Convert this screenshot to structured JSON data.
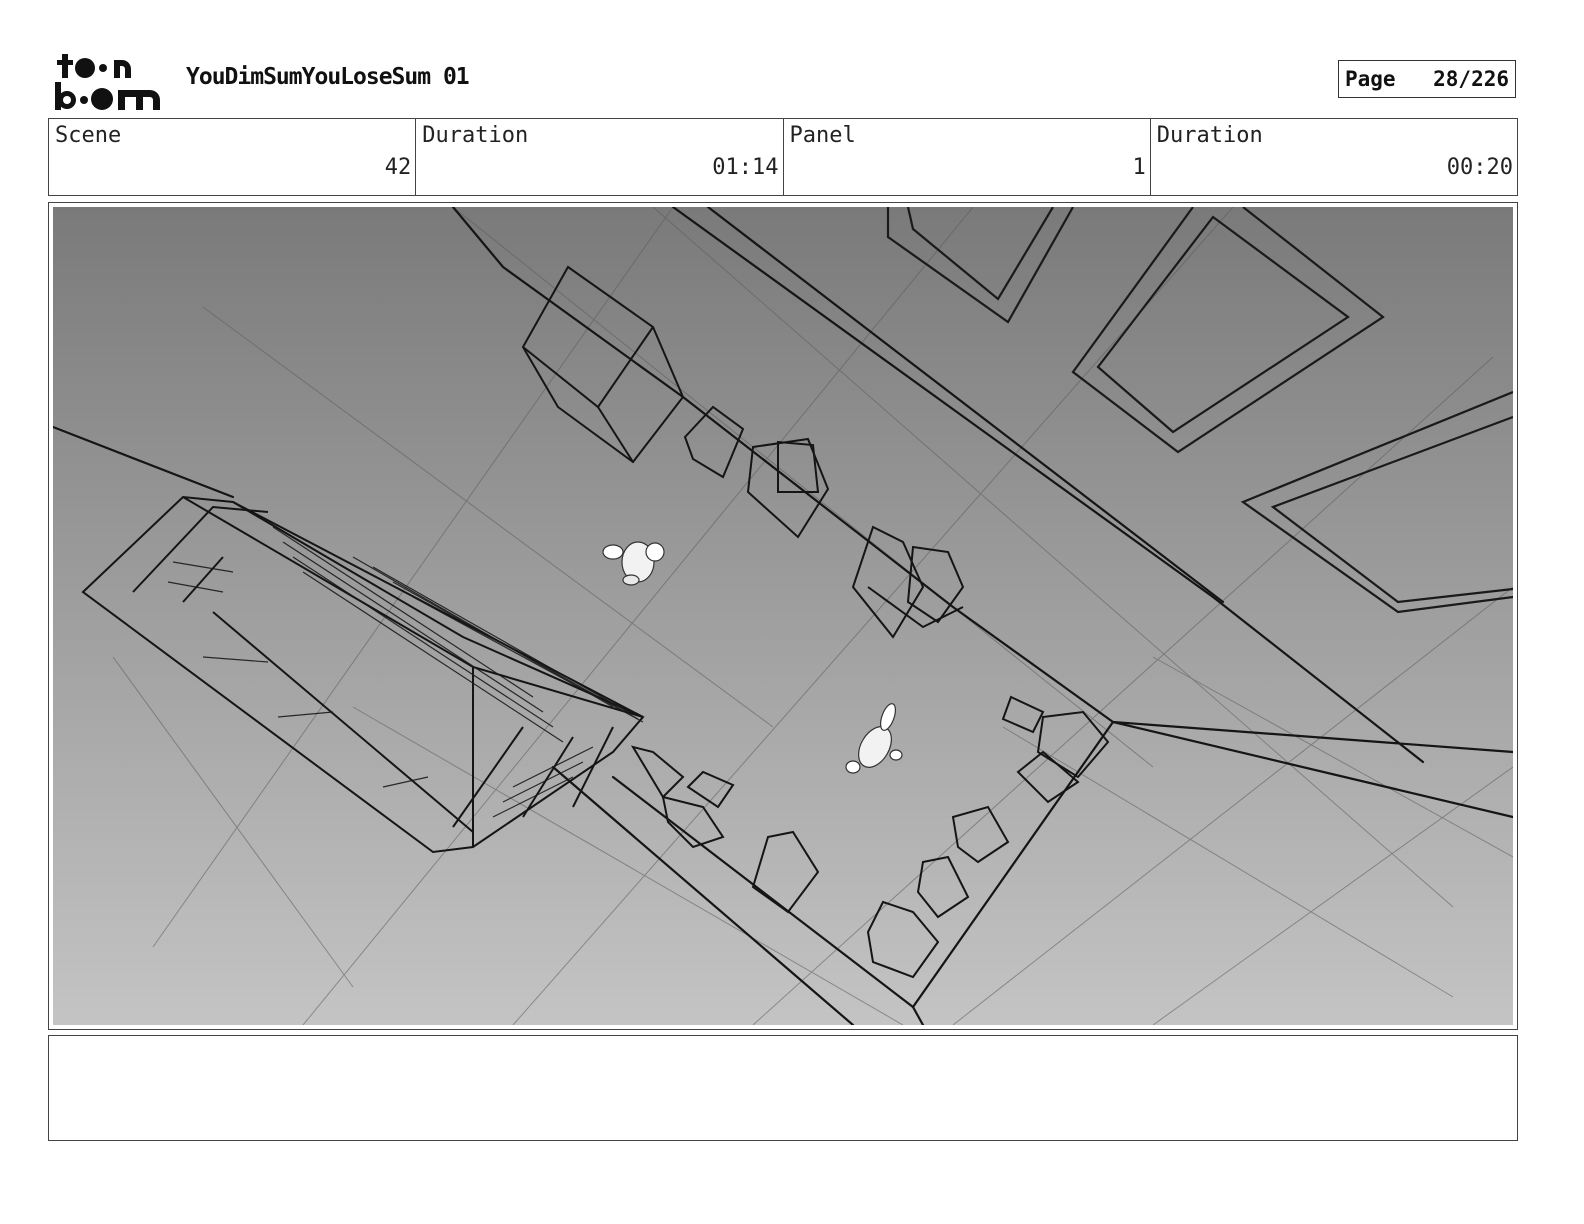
{
  "header": {
    "logo_text": "toon boom",
    "title": "YouDimSumYouLoseSum 01",
    "page_label": "Page",
    "page_number": "28/226"
  },
  "info": [
    {
      "label": "Scene",
      "value": "42"
    },
    {
      "label": "Duration",
      "value": "01:14"
    },
    {
      "label": "Panel",
      "value": "1"
    },
    {
      "label": "Duration",
      "value": "00:20"
    }
  ],
  "panel": {
    "background_top": "#7a7a7a",
    "background_bottom": "#c4c4c4"
  },
  "notes": {
    "text": ""
  }
}
